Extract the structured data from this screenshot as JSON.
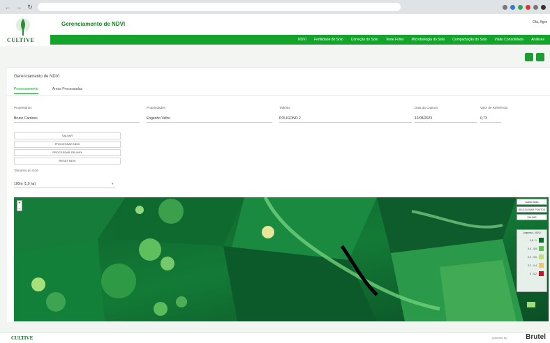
{
  "browser": {
    "url": ""
  },
  "header": {
    "app_title": "Gerenciamento de NDVI",
    "logo_text": "CULTIVE",
    "user": "Olá, Agro"
  },
  "menu": [
    "NDVI",
    "Fertilidade do Solo",
    "Correção do Solo",
    "Teste Foliar",
    "Microbiologia do Solo",
    "Compactação do Solo",
    "Visão Consolidada",
    "Análises"
  ],
  "card": {
    "title": "Gerenciamento de NDVI",
    "tabs": [
      "Processamento",
      "Áreas Processadas"
    ]
  },
  "form": {
    "fields": [
      {
        "label": "Proprietários",
        "value": "Bruno Cardoso"
      },
      {
        "label": "Propriedades",
        "value": "Engenho Velho"
      },
      {
        "label": "Talhões",
        "value": "POLIGONO 2"
      },
      {
        "label": "Data da Captura",
        "value": "12/08/2023"
      },
      {
        "label": "Valor de Referência",
        "value": "0,73"
      }
    ],
    "buttons": [
      "SALVAR",
      "PROCESSAR NDVI",
      "PROCESSAR DELIMIX",
      "RESET NDVI"
    ],
    "size_label": "Tamanho do Grid",
    "size_value": "100m (1,0 ha)"
  },
  "map_controls": {
    "zoom_in": "+",
    "zoom_out": "−",
    "ctl1": "Avaliar talão",
    "ctl2": "SELECIONAR PONTOS",
    "ctl3": "SALVAR"
  },
  "legend": {
    "title": "Legenda - NDVI",
    "entries": [
      "0,8 - 1",
      "0,6 - 0,8",
      "0,4 - 0,6",
      "0,2 - 0,4",
      "0 - 0,2"
    ]
  },
  "legend_colors": [
    "#0f6b2e",
    "#5fbf4f",
    "#bfe07a",
    "#e8c96c",
    "#c0182a"
  ],
  "footer": {
    "logo": "CULTIVE",
    "powered": "powered by",
    "brand": "Brutel"
  }
}
